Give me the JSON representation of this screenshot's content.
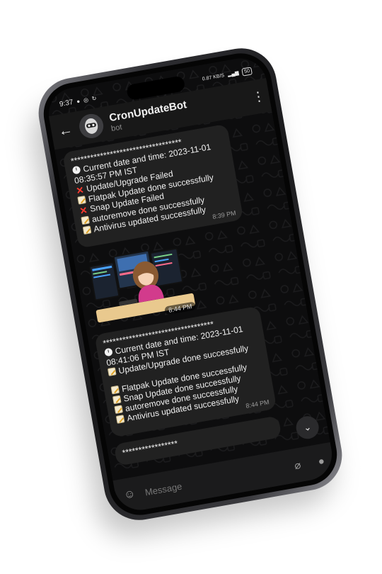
{
  "status": {
    "time": "9:37",
    "right_text": "0.87 KB/S",
    "battery": "50"
  },
  "header": {
    "back_icon": "arrow-left-icon",
    "title": "CronUpdateBot",
    "subtitle": "bot",
    "menu_icon": "more-vert-icon"
  },
  "messages": [
    {
      "divider": "**********************************",
      "lines": [
        {
          "icon": "clock-icon",
          "text": "Current date and time: 2023-11-01 08:35:57 PM IST"
        },
        {
          "icon": "red-x-icon",
          "text": "Update/Upgrade Failed"
        },
        {
          "icon": "memo-icon",
          "text": "Flatpak Update done successfully"
        },
        {
          "icon": "red-x-icon",
          "text": "Snap Update Failed"
        },
        {
          "icon": "memo-icon",
          "text": "autoremove done successfully"
        },
        {
          "icon": "memo-icon",
          "text": "Antivirus updated successfully"
        }
      ],
      "time": "8:39 PM"
    },
    {
      "sticker": "developer-at-monitors-sticker",
      "time": "8:44 PM"
    },
    {
      "divider": "**********************************",
      "lines": [
        {
          "icon": "clock-icon",
          "text": "Current date and time: 2023-11-01 08:41:06 PM IST"
        },
        {
          "icon": "memo-icon",
          "text": "Update/Upgrade done successfully"
        },
        {
          "icon": "memo-icon",
          "text": "Flatpak Update done successfully"
        },
        {
          "icon": "memo-icon",
          "text": "Snap Update done successfully"
        },
        {
          "icon": "memo-icon",
          "text": "autoremove done successfully"
        },
        {
          "icon": "memo-icon",
          "text": "Antivirus updated successfully"
        }
      ],
      "time": "8:44 PM"
    },
    {
      "divider": "*****************"
    }
  ],
  "composer": {
    "placeholder": "Message",
    "emoji_icon": "emoji-icon",
    "attach_icon": "paperclip-icon",
    "mic_icon": "microphone-icon"
  },
  "colors": {
    "bubble": "#212121",
    "background": "#0d0d0e",
    "error": "#ff3b30"
  }
}
